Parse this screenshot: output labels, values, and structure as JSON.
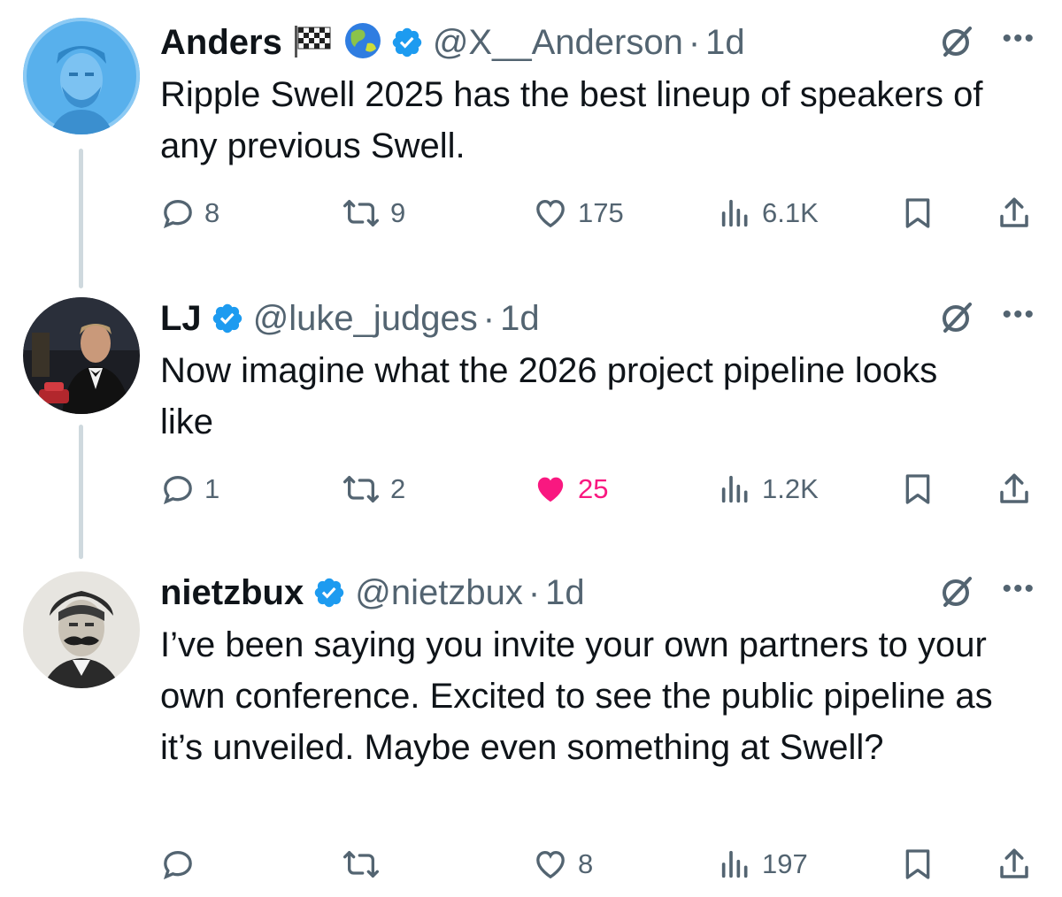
{
  "tweets": [
    {
      "name": "Anders",
      "emojis": [
        "🏁",
        "🌏"
      ],
      "handle": "@X__Anderson",
      "dot": "·",
      "time": "1d",
      "text": "Ripple Swell 2025 has the best lineup of speakers of any previous Swell.",
      "replies": "8",
      "reposts": "9",
      "likes": "175",
      "views": "6.1K",
      "liked": false,
      "avatar": "avatar-blue-sketch"
    },
    {
      "name": "LJ",
      "emojis": [],
      "handle": "@luke_judges",
      "dot": "·",
      "time": "1d",
      "text": "Now imagine what the 2026 project pipeline looks like",
      "replies": "1",
      "reposts": "2",
      "likes": "25",
      "views": "1.2K",
      "liked": true,
      "avatar": "avatar-tuxedo-photo"
    },
    {
      "name": "nietzbux",
      "emojis": [],
      "handle": "@nietzbux",
      "dot": "·",
      "time": "1d",
      "text": "I’ve been saying you invite your own partners to your own conference. Excited to see the public pipeline as it’s unveiled. Maybe even something at Swell?",
      "replies": "",
      "reposts": "",
      "likes": "8",
      "views": "197",
      "liked": false,
      "avatar": "avatar-mustache-portrait"
    }
  ],
  "colors": {
    "muted": "#536471",
    "text": "#0f1419",
    "verified": "#1d9bf0",
    "like": "#f91880",
    "thread": "#cfd9de"
  },
  "icons": [
    "verified-badge-icon",
    "grok-icon",
    "more-icon",
    "reply-icon",
    "repost-icon",
    "like-icon",
    "views-icon",
    "bookmark-icon",
    "share-icon"
  ]
}
